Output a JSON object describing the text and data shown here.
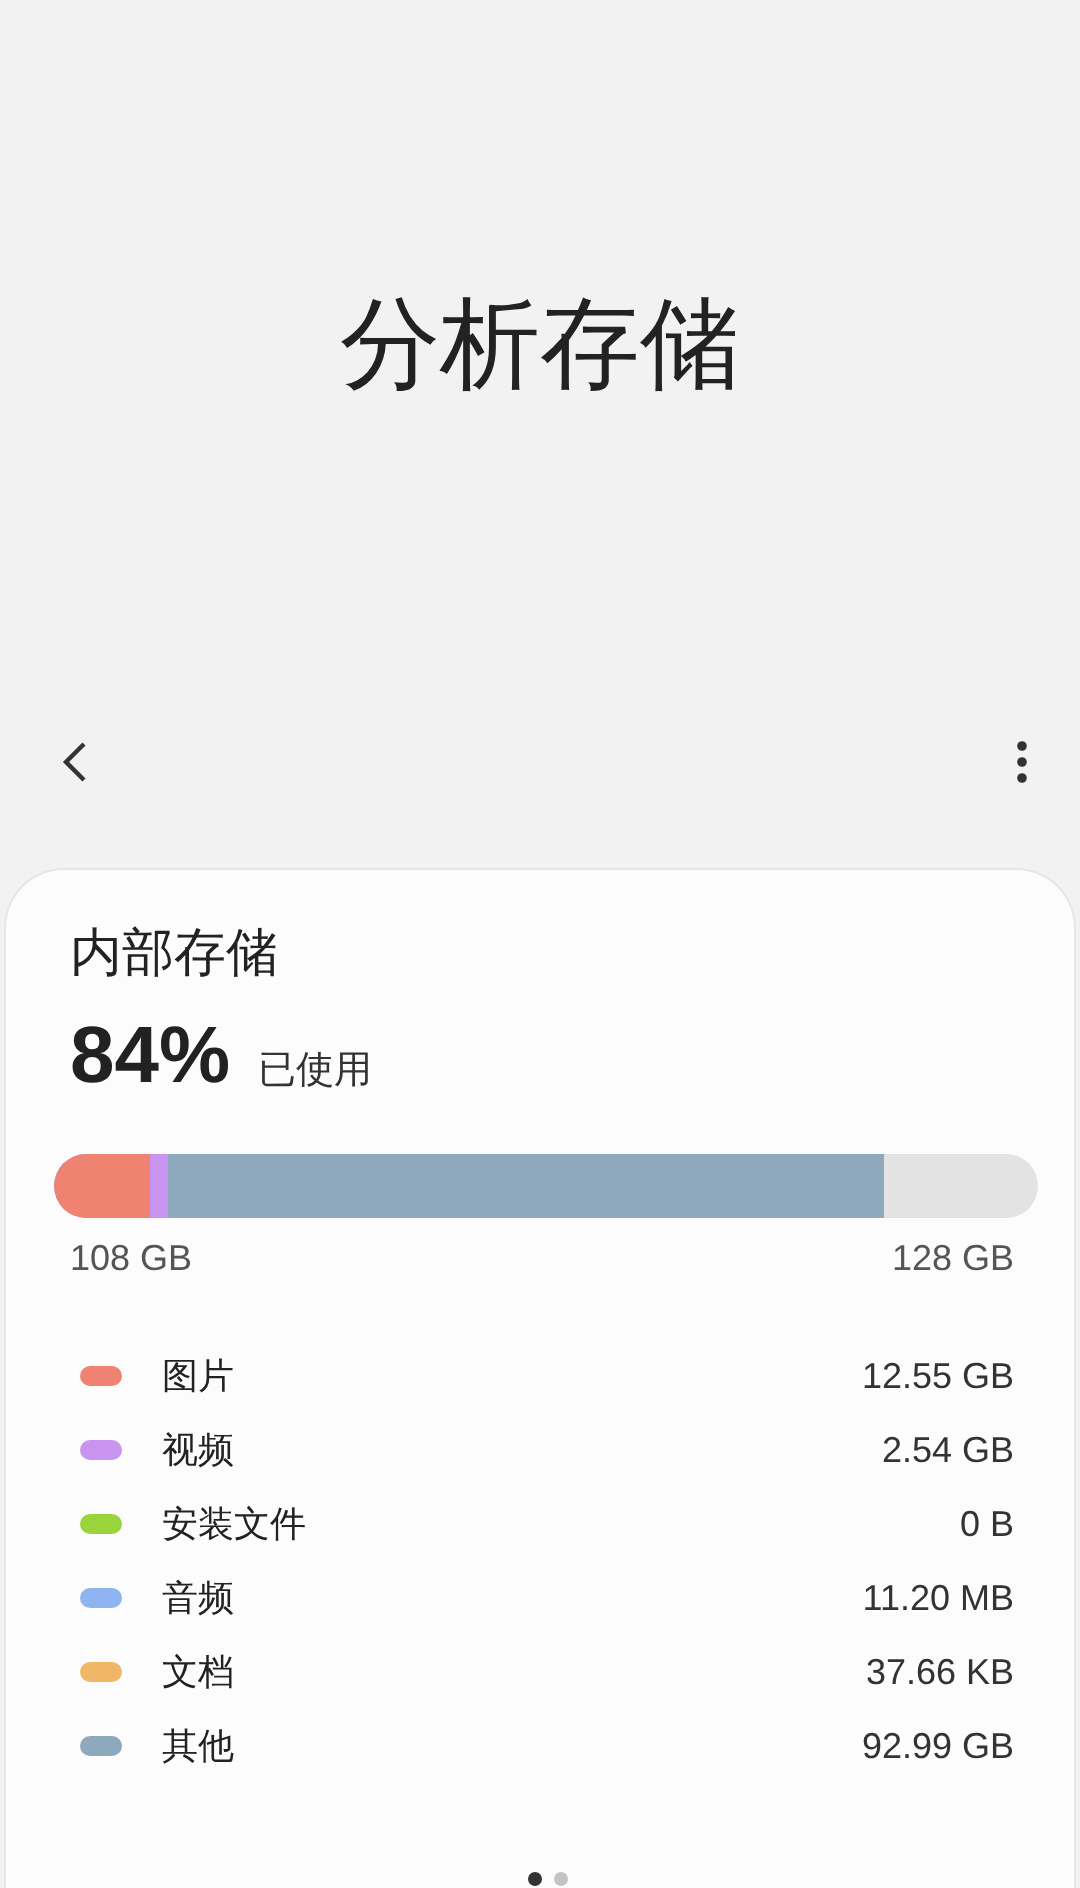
{
  "page_title": "分析存储",
  "storage": {
    "title": "内部存储",
    "percent": "84%",
    "used_label": "已使用",
    "bar": [
      {
        "color": "#f08272",
        "level": 0.098
      },
      {
        "color": "#c994ef",
        "level": 0.116
      },
      {
        "color": "#8ea9bc",
        "level": 0.844
      }
    ],
    "used": "108 GB",
    "total": "128 GB",
    "categories": [
      {
        "name": "图片",
        "size": "12.55 GB",
        "color": "#f08272"
      },
      {
        "name": "视频",
        "size": "2.54 GB",
        "color": "#c994ef"
      },
      {
        "name": "安装文件",
        "size": "0 B",
        "color": "#9ad43c"
      },
      {
        "name": "音频",
        "size": "11.20 MB",
        "color": "#8fb4f2"
      },
      {
        "name": "文档",
        "size": "37.66 KB",
        "color": "#f0b866"
      },
      {
        "name": "其他",
        "size": "92.99 GB",
        "color": "#8ea9bc"
      }
    ]
  },
  "pages": [
    {
      "selected": true
    },
    {
      "selected": false
    }
  ]
}
